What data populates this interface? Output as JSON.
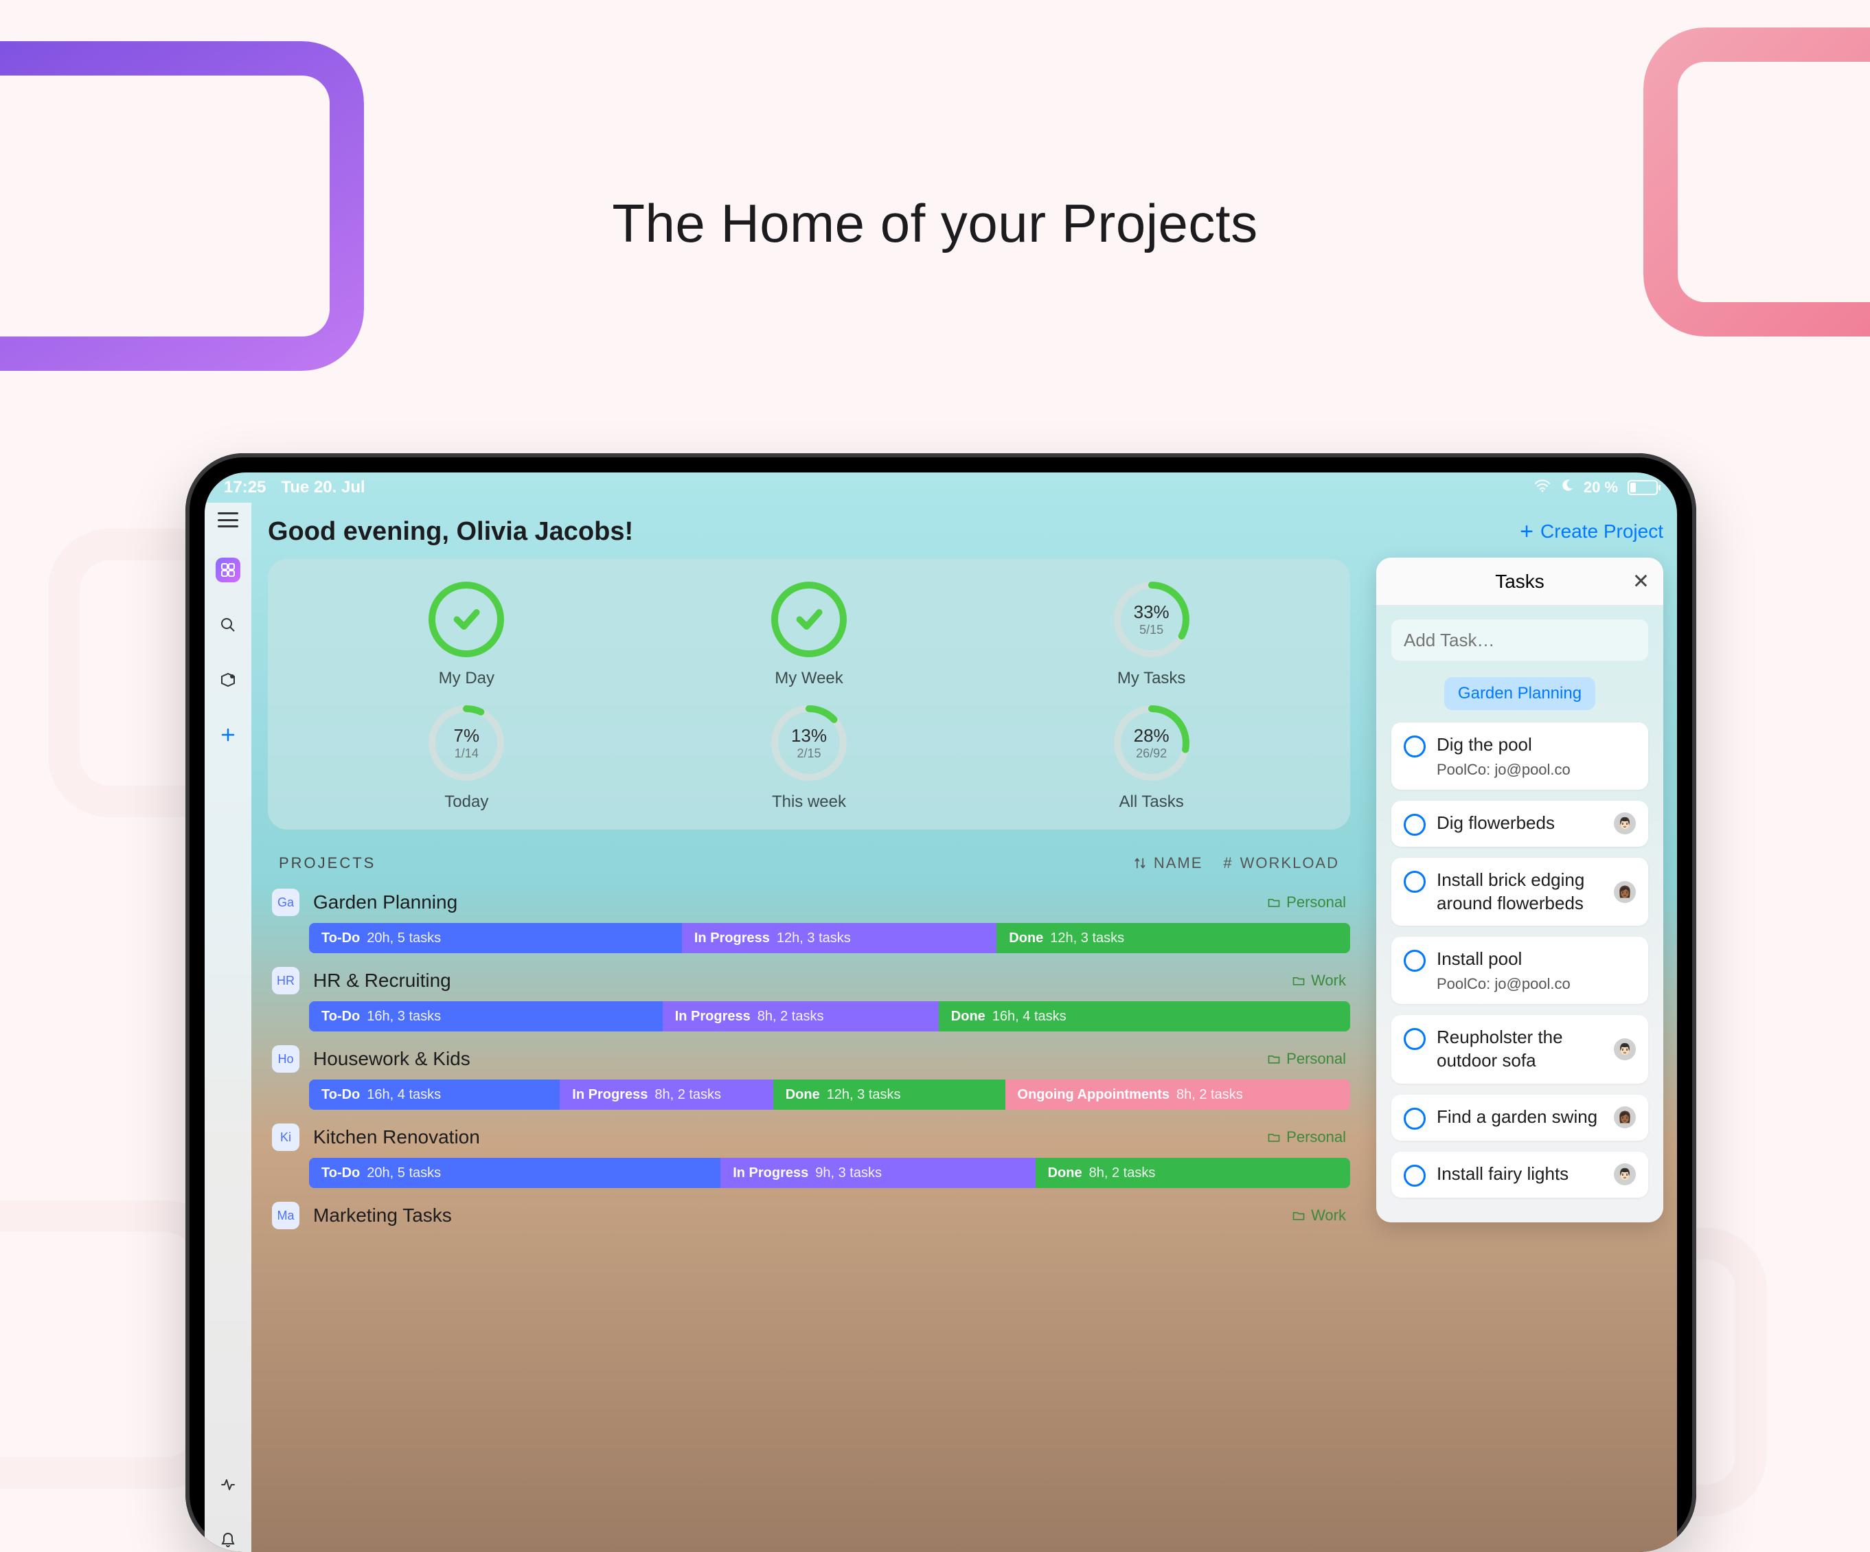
{
  "marketing_title": "The Home of your Projects",
  "statusbar": {
    "time": "17:25",
    "date": "Tue 20. Jul",
    "battery_pct": "20 %"
  },
  "rail": {
    "items": [
      "menu",
      "home",
      "search",
      "inbox",
      "add",
      "activity",
      "notifications"
    ]
  },
  "header": {
    "greeting": "Good evening, Olivia Jacobs!",
    "create_label": "Create Project"
  },
  "stats": {
    "row1": [
      {
        "label": "My Day",
        "complete": true,
        "pct": 100
      },
      {
        "label": "My Week",
        "complete": true,
        "pct": 100
      },
      {
        "label": "My Tasks",
        "complete": false,
        "pct": 33,
        "pct_label": "33%",
        "frac": "5/15"
      }
    ],
    "row2": [
      {
        "label": "Today",
        "complete": false,
        "pct": 7,
        "pct_label": "7%",
        "frac": "1/14"
      },
      {
        "label": "This week",
        "complete": false,
        "pct": 13,
        "pct_label": "13%",
        "frac": "2/15"
      },
      {
        "label": "All Tasks",
        "complete": false,
        "pct": 28,
        "pct_label": "28%",
        "frac": "26/92"
      }
    ]
  },
  "tasks_panel": {
    "title": "Tasks",
    "add_placeholder": "Add Task…",
    "chip": "Garden Planning",
    "items": [
      {
        "title": "Dig the pool",
        "sub": "PoolCo: jo@pool.co",
        "avatar": null
      },
      {
        "title": "Dig flowerbeds",
        "sub": null,
        "avatar": "👨🏻"
      },
      {
        "title": "Install brick edging around flowerbeds",
        "sub": null,
        "avatar": "👩🏾"
      },
      {
        "title": "Install pool",
        "sub": "PoolCo: jo@pool.co",
        "avatar": null
      },
      {
        "title": "Reupholster the outdoor sofa",
        "sub": null,
        "avatar": "👨🏻"
      },
      {
        "title": "Find a garden swing",
        "sub": null,
        "avatar": "👩🏾"
      },
      {
        "title": "Install fairy lights",
        "sub": null,
        "avatar": "👨🏻"
      }
    ]
  },
  "projects_section": {
    "title": "PROJECTS",
    "sort_name": "NAME",
    "sort_workload": "WORKLOAD",
    "items": [
      {
        "badge": "Ga",
        "name": "Garden Planning",
        "folder": "Personal",
        "segments": [
          {
            "cls": "todo",
            "lab": "To-Do",
            "det": "20h, 5 tasks",
            "w": 36
          },
          {
            "cls": "prog",
            "lab": "In Progress",
            "det": "12h, 3 tasks",
            "w": 30
          },
          {
            "cls": "done",
            "lab": "Done",
            "det": "12h, 3 tasks",
            "w": 34
          }
        ]
      },
      {
        "badge": "HR",
        "name": "HR & Recruiting",
        "folder": "Work",
        "segments": [
          {
            "cls": "todo",
            "lab": "To-Do",
            "det": "16h, 3 tasks",
            "w": 34
          },
          {
            "cls": "prog",
            "lab": "In Progress",
            "det": "8h, 2 tasks",
            "w": 26
          },
          {
            "cls": "done",
            "lab": "Done",
            "det": "16h, 4 tasks",
            "w": 40
          }
        ]
      },
      {
        "badge": "Ho",
        "name": "Housework & Kids",
        "folder": "Personal",
        "segments": [
          {
            "cls": "todo",
            "lab": "To-Do",
            "det": "16h, 4 tasks",
            "w": 24
          },
          {
            "cls": "prog",
            "lab": "In Progress",
            "det": "8h, 2 tasks",
            "w": 20
          },
          {
            "cls": "done",
            "lab": "Done",
            "det": "12h, 3 tasks",
            "w": 22
          },
          {
            "cls": "ongoing",
            "lab": "Ongoing Appointments",
            "det": "8h, 2 tasks",
            "w": 34
          }
        ]
      },
      {
        "badge": "Ki",
        "name": "Kitchen Renovation",
        "folder": "Personal",
        "segments": [
          {
            "cls": "todo",
            "lab": "To-Do",
            "det": "20h, 5 tasks",
            "w": 40
          },
          {
            "cls": "prog",
            "lab": "In Progress",
            "det": "9h, 3 tasks",
            "w": 30
          },
          {
            "cls": "done",
            "lab": "Done",
            "det": "8h, 2 tasks",
            "w": 30
          }
        ]
      },
      {
        "badge": "Ma",
        "name": "Marketing Tasks",
        "folder": "Work",
        "segments": []
      }
    ]
  }
}
